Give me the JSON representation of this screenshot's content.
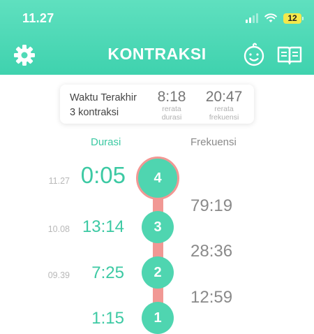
{
  "status_bar": {
    "time": "11.27",
    "battery": "12"
  },
  "header": {
    "title": "KONTRAKSI",
    "settings_icon": "gear-icon",
    "baby_icon": "baby-face-icon",
    "book_icon": "open-book-icon"
  },
  "summary": {
    "line1": "Waktu Terakhir",
    "line2": "3 kontraksi",
    "avg_duration_value": "8:18",
    "avg_duration_caption_1": "rerata",
    "avg_duration_caption_2": "durasi",
    "avg_frequency_value": "20:47",
    "avg_frequency_caption_1": "rerata",
    "avg_frequency_caption_2": "frekuensi"
  },
  "columns": {
    "duration": "Durasi",
    "frequency": "Frekuensi"
  },
  "contractions": [
    {
      "number": "4",
      "start": "11.27",
      "duration": "0:05"
    },
    {
      "number": "3",
      "start": "10.08",
      "duration": "13:14"
    },
    {
      "number": "2",
      "start": "09.39",
      "duration": "7:25"
    },
    {
      "number": "1",
      "start": "",
      "duration": "1:15"
    }
  ],
  "frequencies": [
    "79:19",
    "28:36",
    "12:59"
  ],
  "colors": {
    "accent": "#4fd5b0",
    "rail": "#f19894",
    "header": "#5fe0bf"
  }
}
